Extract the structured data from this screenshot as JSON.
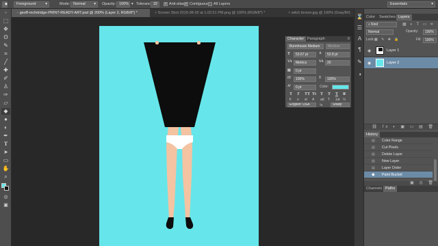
{
  "options_bar": {
    "preset": "Foreground",
    "mode_label": "Mode:",
    "mode_value": "Normal",
    "opacity_label": "Opacity:",
    "opacity_value": "100%",
    "tolerance_label": "Tolerance:",
    "tolerance_value": "32",
    "anti_alias_label": "Anti-alias",
    "contiguous_label": "Contiguous",
    "all_layers_label": "All Layers",
    "workspace": "Essentials"
  },
  "tabs": [
    {
      "label": "geoff-mcfetridge-PRINT-READY-ART.psd @ 200% (Layer 2, RGB/8*) *",
      "active": true
    },
    {
      "label": "Screen Shot 2015-08-02 at 1.02.51 PM.png @ 100% (RGB/8*) *",
      "active": false
    },
    {
      "label": "witch broom.jpg @ 100% (Gray/8#)",
      "active": false
    }
  ],
  "character_panel": {
    "tab_character": "Character",
    "tab_paragraph": "Paragraph",
    "font_family": "Bunnhouse Medium",
    "font_style": "Medium",
    "font_size": "53.67 pt",
    "leading": "52.8 pt",
    "kerning": "Metrics",
    "tracking": "20",
    "baseline_shift_label": "0 pt",
    "vertical_scale": "100%",
    "horizontal_scale": "100%",
    "baseline": "0 pt",
    "color_label": "Color:",
    "type_buttons": [
      "T",
      "T",
      "TT",
      "Tt",
      "T",
      "T",
      "T",
      "T"
    ],
    "feature_buttons": [
      "fi",
      "o",
      "st",
      "A",
      "ad",
      "T",
      "1st",
      "½"
    ],
    "language": "English: USA",
    "antialias": "Sharp"
  },
  "layers_panel": {
    "tabs": [
      "Color",
      "Swatches",
      "Layers"
    ],
    "active_tab": "Layers",
    "filter": "Kind",
    "blend_mode": "Normal",
    "opacity_label": "Opacity:",
    "opacity_value": "100%",
    "lock_label": "Lock:",
    "fill_label": "Fill:",
    "fill_value": "100%",
    "layers": [
      {
        "name": "Layer 1",
        "selected": false
      },
      {
        "name": "Layer 2",
        "selected": true
      }
    ]
  },
  "history_panel": {
    "title": "History",
    "items": [
      {
        "label": "Color Range",
        "selected": false
      },
      {
        "label": "Cut Pixels",
        "selected": false
      },
      {
        "label": "Delete Layer",
        "selected": false
      },
      {
        "label": "New Layer",
        "selected": false
      },
      {
        "label": "Layer Order",
        "selected": false
      },
      {
        "label": "Paint Bucket",
        "selected": true
      }
    ]
  },
  "bottom_tabs": [
    "Channels",
    "Paths"
  ],
  "colors": {
    "canvas_bg": "#66e6ea",
    "selection": "#6c8ba6",
    "color_swatch": "#66e6ea",
    "figure_black": "#0d0d0d",
    "skin": "#f3c3a2"
  },
  "icons": [
    "marquee",
    "move",
    "lasso",
    "crop",
    "eyedropper",
    "brush",
    "stamp",
    "eraser",
    "paint-bucket",
    "blur",
    "dodge",
    "pen",
    "type",
    "path-select",
    "shape",
    "hand",
    "zoom"
  ]
}
